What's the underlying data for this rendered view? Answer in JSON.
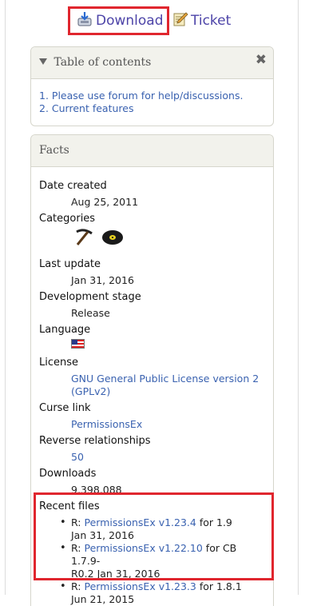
{
  "top_links": {
    "download_label": "Download",
    "ticket_label": "Ticket"
  },
  "toc": {
    "title": "Table of contents",
    "items": [
      "1. Please use forum for help/discussions.",
      "2. Current features"
    ]
  },
  "facts": {
    "title": "Facts",
    "date_created_label": "Date created",
    "date_created": "Aug 25, 2011",
    "categories_label": "Categories",
    "categories_icons": [
      "pickaxe-icon",
      "disc-icon"
    ],
    "last_update_label": "Last update",
    "last_update": "Jan 31, 2016",
    "dev_stage_label": "Development stage",
    "dev_stage": "Release",
    "language_label": "Language",
    "language_icon": "us-flag-icon",
    "license_label": "License",
    "license_line1": "GNU General Public License version 2",
    "license_line2": "(GPLv2)",
    "curse_label": "Curse link",
    "curse_link": "PermissionsEx",
    "reverse_label": "Reverse relationships",
    "reverse_value": "50",
    "downloads_label": "Downloads",
    "downloads_value": "9,398,088",
    "recent_label": "Recent files",
    "recent_files": [
      {
        "prefix": "R:",
        "name": "PermissionsEx v1.23.4",
        "for": "for 1.9",
        "date": "Jan 31, 2016"
      },
      {
        "prefix": "R:",
        "name": "PermissionsEx v1.22.10",
        "for": "for CB 1.7.9-",
        "for2": "R0.2",
        "date": "Jan 31, 2016"
      },
      {
        "prefix": "R:",
        "name": "PermissionsEx v1.23.3",
        "for": "for 1.8.1",
        "date": "Jun 21, 2015"
      }
    ]
  },
  "colors": {
    "link": "#3a62b0",
    "highlight_red": "#e0262e",
    "panel_header_bg": "#f2f2ec"
  }
}
